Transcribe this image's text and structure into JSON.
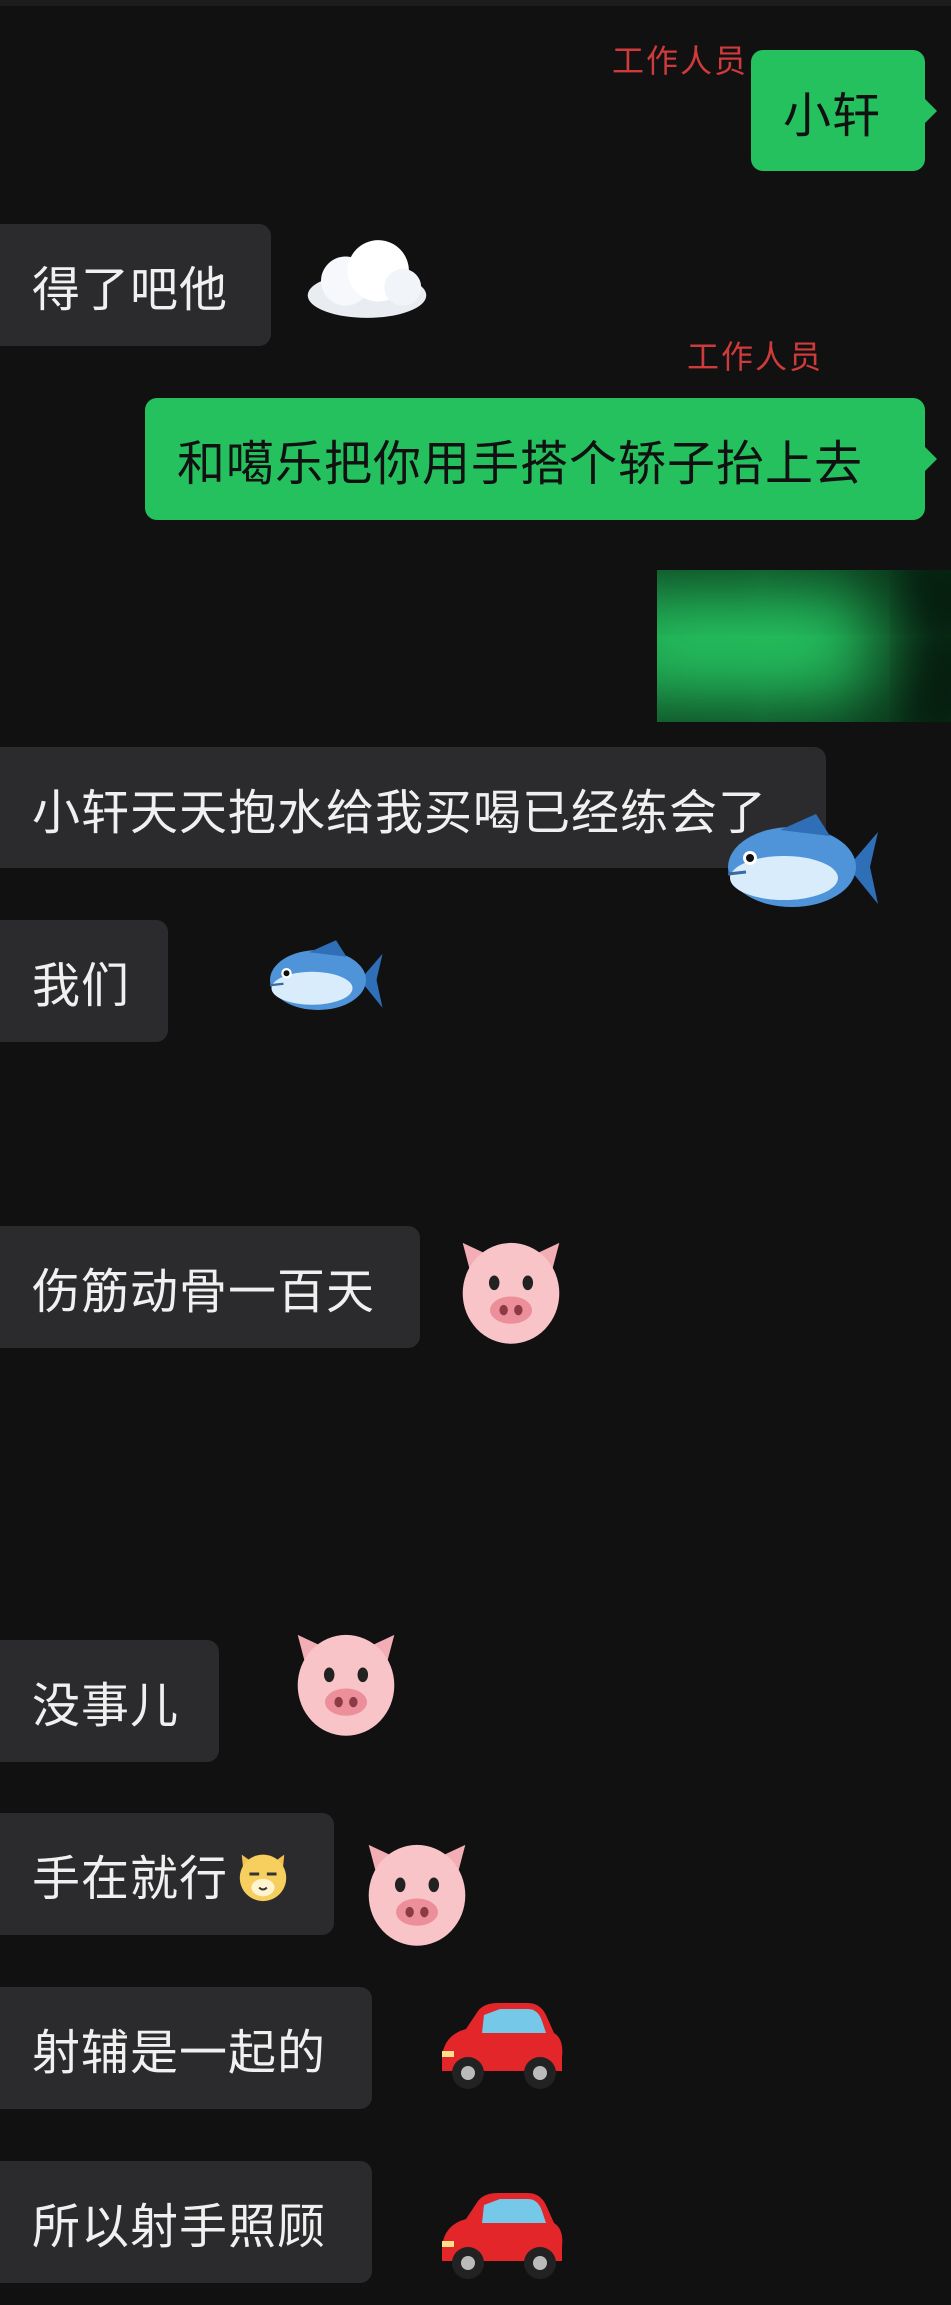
{
  "staff_label": "工作人员",
  "messages": {
    "m1": "小轩",
    "m2": "得了吧他",
    "m3": "和噶乐把你用手搭个轿子抬上去",
    "m4": "小轩天天抱水给我买喝已经练会了",
    "m5": "我们",
    "m6": "伤筋动骨一百天",
    "m7": "没事儿",
    "m8": "手在就行",
    "m9": "射辅是一起的",
    "m10": "所以射手照顾"
  },
  "emojis": [
    "cloud",
    "fish",
    "fish",
    "pig",
    "pig",
    "cat-face",
    "pig",
    "red-car",
    "red-car"
  ],
  "colors": {
    "background": "#111112",
    "received_bubble": "#2b2b2d",
    "sent_bubble": "#25c15f",
    "staff_label": "#cf3a3a"
  }
}
